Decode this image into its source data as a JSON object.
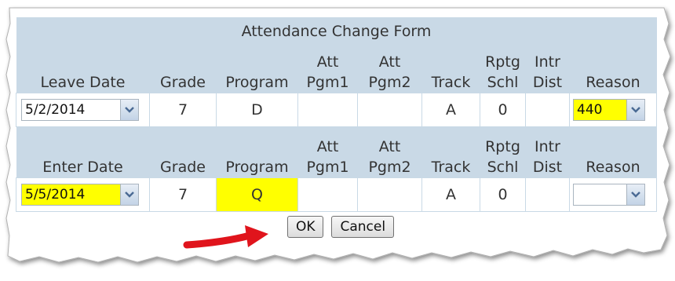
{
  "form": {
    "title": "Attendance Change Form",
    "columns": {
      "grade": "Grade",
      "program": "Program",
      "att_pgm1_line1": "Att",
      "att_pgm1_line2": "Pgm1",
      "att_pgm2_line1": "Att",
      "att_pgm2_line2": "Pgm2",
      "track": "Track",
      "rptg_schl_line1": "Rptg",
      "rptg_schl_line2": "Schl",
      "intr_dist_line1": "Intr",
      "intr_dist_line2": "Dist",
      "reason": "Reason"
    },
    "leave": {
      "date_label": "Leave Date",
      "date": "5/2/2014",
      "grade": "7",
      "program": "D",
      "att_pgm1": "",
      "att_pgm2": "",
      "track": "A",
      "rptg_schl": "0",
      "intr_dist": "",
      "reason": "440"
    },
    "enter": {
      "date_label": "Enter Date",
      "date": "5/5/2014",
      "grade": "7",
      "program": "Q",
      "att_pgm1": "",
      "att_pgm2": "",
      "track": "A",
      "rptg_schl": "0",
      "intr_dist": "",
      "reason": ""
    },
    "buttons": {
      "ok": "OK",
      "cancel": "Cancel"
    }
  },
  "colors": {
    "header_bg": "#c9d9e6",
    "highlight": "#ffff00",
    "arrow": "#e0141c"
  }
}
